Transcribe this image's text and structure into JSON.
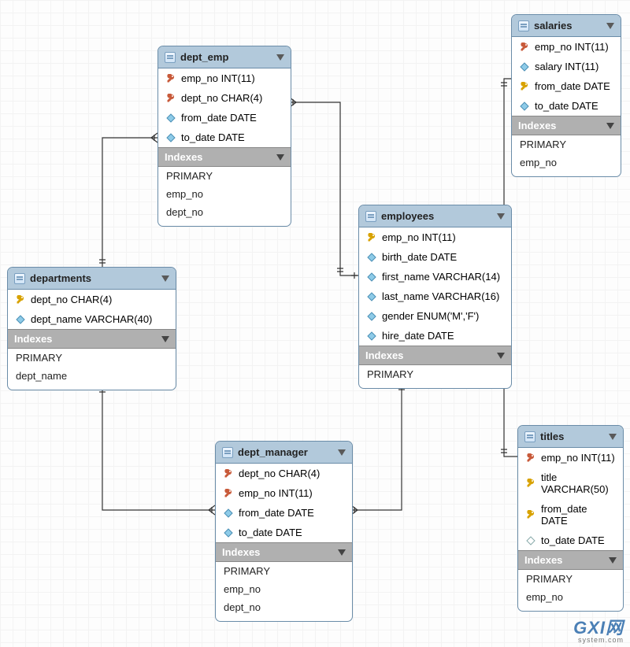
{
  "watermark": {
    "main": "GXI网",
    "sub": "system.com"
  },
  "tables": {
    "dept_emp": {
      "title": "dept_emp",
      "columns": [
        {
          "icon": "key-r",
          "text": "emp_no INT(11)"
        },
        {
          "icon": "key-r",
          "text": "dept_no CHAR(4)"
        },
        {
          "icon": "diamond-f",
          "text": "from_date DATE"
        },
        {
          "icon": "diamond-f",
          "text": "to_date DATE"
        }
      ],
      "index_label": "Indexes",
      "indexes": [
        "PRIMARY",
        "emp_no",
        "dept_no"
      ]
    },
    "salaries": {
      "title": "salaries",
      "columns": [
        {
          "icon": "key-r",
          "text": "emp_no INT(11)"
        },
        {
          "icon": "diamond-f",
          "text": "salary INT(11)"
        },
        {
          "icon": "key-y",
          "text": "from_date DATE"
        },
        {
          "icon": "diamond-f",
          "text": "to_date DATE"
        }
      ],
      "index_label": "Indexes",
      "indexes": [
        "PRIMARY",
        "emp_no"
      ]
    },
    "departments": {
      "title": "departments",
      "columns": [
        {
          "icon": "key-y",
          "text": "dept_no CHAR(4)"
        },
        {
          "icon": "diamond-f",
          "text": "dept_name VARCHAR(40)"
        }
      ],
      "index_label": "Indexes",
      "indexes": [
        "PRIMARY",
        "dept_name"
      ]
    },
    "employees": {
      "title": "employees",
      "columns": [
        {
          "icon": "key-y",
          "text": "emp_no INT(11)"
        },
        {
          "icon": "diamond-f",
          "text": "birth_date DATE"
        },
        {
          "icon": "diamond-f",
          "text": "first_name VARCHAR(14)"
        },
        {
          "icon": "diamond-f",
          "text": "last_name VARCHAR(16)"
        },
        {
          "icon": "diamond-f",
          "text": "gender ENUM('M','F')"
        },
        {
          "icon": "diamond-f",
          "text": "hire_date DATE"
        }
      ],
      "index_label": "Indexes",
      "indexes": [
        "PRIMARY"
      ]
    },
    "dept_manager": {
      "title": "dept_manager",
      "columns": [
        {
          "icon": "key-r",
          "text": "dept_no CHAR(4)"
        },
        {
          "icon": "key-r",
          "text": "emp_no INT(11)"
        },
        {
          "icon": "diamond-f",
          "text": "from_date DATE"
        },
        {
          "icon": "diamond-f",
          "text": "to_date DATE"
        }
      ],
      "index_label": "Indexes",
      "indexes": [
        "PRIMARY",
        "emp_no",
        "dept_no"
      ]
    },
    "titles": {
      "title": "titles",
      "columns": [
        {
          "icon": "key-r",
          "text": "emp_no INT(11)"
        },
        {
          "icon": "key-y",
          "text": "title VARCHAR(50)"
        },
        {
          "icon": "key-y",
          "text": "from_date DATE"
        },
        {
          "icon": "diamond-o",
          "text": "to_date DATE"
        }
      ],
      "index_label": "Indexes",
      "indexes": [
        "PRIMARY",
        "emp_no"
      ]
    }
  }
}
